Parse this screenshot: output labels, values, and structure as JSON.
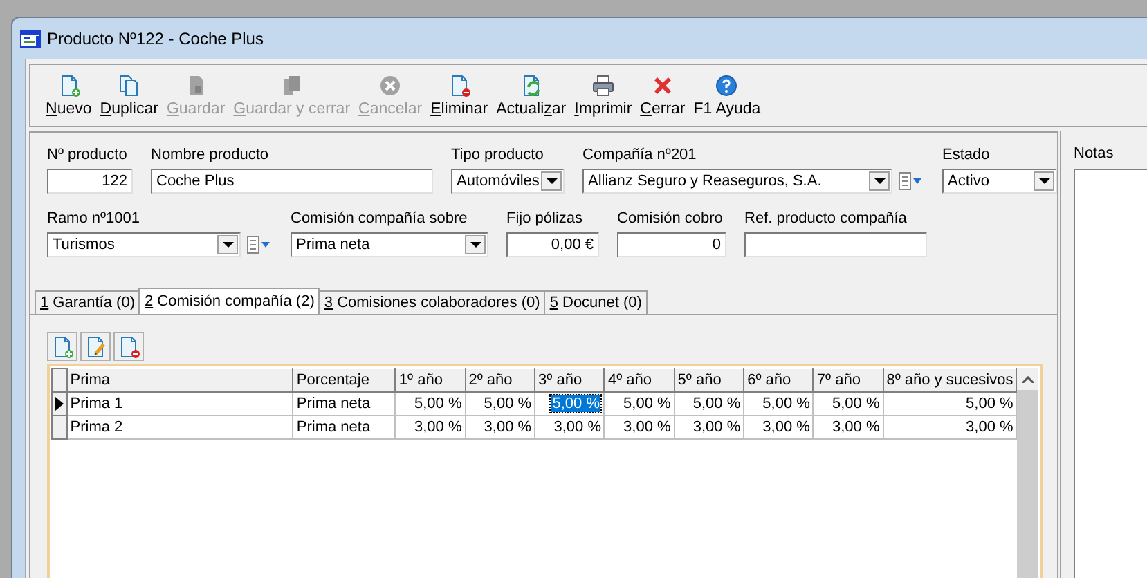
{
  "window": {
    "title": "Producto Nº122 - Coche Plus"
  },
  "toolbar": [
    {
      "access_key": "N",
      "label_end": "uevo",
      "disabled": false,
      "kind": "new"
    },
    {
      "access_key": "D",
      "label_end": "uplicar",
      "disabled": false,
      "kind": "duplicate"
    },
    {
      "access_key": "G",
      "label_end": "uardar",
      "disabled": true,
      "kind": "save"
    },
    {
      "access_key": "G",
      "label_end": "uardar y cerrar",
      "disabled": true,
      "kind": "saveclose"
    },
    {
      "access_key": "C",
      "label_end": "ancelar",
      "disabled": true,
      "kind": "cancel"
    },
    {
      "access_key": "E",
      "label_end": "liminar",
      "disabled": false,
      "kind": "delete"
    },
    {
      "label_start": "Actuali",
      "access_key": "z",
      "label_end": "ar",
      "disabled": false,
      "kind": "refresh"
    },
    {
      "access_key": "I",
      "label_end": "mprimir",
      "disabled": false,
      "kind": "print"
    },
    {
      "access_key": "C",
      "label_end": "errar",
      "disabled": false,
      "kind": "close"
    },
    {
      "label_start": "F1 Ayuda",
      "disabled": false,
      "kind": "help"
    }
  ],
  "form_rows": [
    [
      {
        "label": "Nº producto",
        "kind": "number",
        "value": "122"
      },
      {
        "label": "Nombre producto",
        "kind": "text",
        "value": "Coche Plus"
      },
      {
        "label": "Tipo producto",
        "kind": "select",
        "value": "Automóviles"
      },
      {
        "label": "Compañía nº201",
        "kind": "select",
        "value": "Allianz Seguro y Reaseguros, S.A.",
        "picker": true
      },
      {
        "label": "Estado",
        "kind": "select",
        "value": "Activo"
      }
    ],
    [
      {
        "label": "Ramo nº1001",
        "kind": "select",
        "value": "Turismos",
        "picker": true
      },
      {
        "label": "Comisión compañía sobre",
        "kind": "select",
        "value": "Prima neta"
      },
      {
        "label": "Fijo pólizas",
        "kind": "number",
        "value": "0,00 €"
      },
      {
        "label": "Comisión cobro",
        "kind": "number",
        "value": "0"
      },
      {
        "label": "Ref. producto compañía",
        "kind": "text"
      }
    ]
  ],
  "tabs": [
    {
      "access_key": "1",
      "label_end": " Garantía (0)",
      "selected": false
    },
    {
      "access_key": "2",
      "label_end": " Comisión compañía (2)",
      "selected": true
    },
    {
      "access_key": "3",
      "label_end": " Comisiones colaboradores (0)",
      "selected": false
    },
    {
      "access_key": "5",
      "label_end": " Docunet (0)",
      "selected": false
    }
  ],
  "grid_toolbar": [
    {
      "kind": "add"
    },
    {
      "kind": "edit"
    },
    {
      "kind": "remove"
    }
  ],
  "table": {
    "columns": [
      "Prima",
      "Porcentaje",
      "1º año",
      "2º año",
      "3º año",
      "4º año",
      "5º año",
      "6º año",
      "7º año",
      "8º año y sucesivos"
    ],
    "rows": [
      {
        "selected": true,
        "cells": [
          {
            "text": "Prima 1",
            "selected": false
          },
          {
            "text": "Prima neta",
            "selected": false
          },
          {
            "text": "5,00 %",
            "selected": false
          },
          {
            "text": "5,00 %",
            "selected": false
          },
          {
            "text": "5,00 %",
            "selected": true
          },
          {
            "text": "5,00 %",
            "selected": false
          },
          {
            "text": "5,00 %",
            "selected": false
          },
          {
            "text": "5,00 %",
            "selected": false
          },
          {
            "text": "5,00 %",
            "selected": false
          },
          {
            "text": "5,00 %",
            "selected": false
          }
        ]
      },
      {
        "selected": false,
        "cells": [
          {
            "text": "Prima 2",
            "selected": false
          },
          {
            "text": "Prima neta",
            "selected": false
          },
          {
            "text": "3,00 %",
            "selected": false
          },
          {
            "text": "3,00 %",
            "selected": false
          },
          {
            "text": "3,00 %",
            "selected": false
          },
          {
            "text": "3,00 %",
            "selected": false
          },
          {
            "text": "3,00 %",
            "selected": false
          },
          {
            "text": "3,00 %",
            "selected": false
          },
          {
            "text": "3,00 %",
            "selected": false
          },
          {
            "text": "3,00 %",
            "selected": false
          }
        ]
      }
    ]
  },
  "notes": {
    "label": "Notas"
  }
}
